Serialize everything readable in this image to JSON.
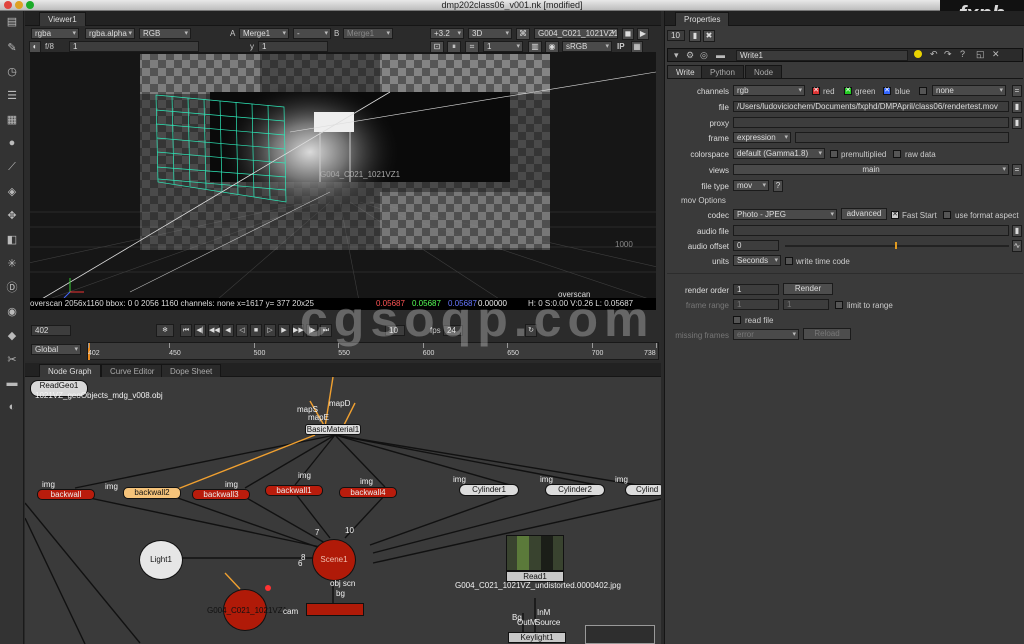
{
  "window": {
    "title": "dmp202class06_v001.nk [modified]",
    "logo": "fxph"
  },
  "viewer": {
    "tab": "Viewer1",
    "channels": "rgba",
    "alpha": "rgba.alpha",
    "display": "RGB",
    "a_label": "A",
    "a_input": "Merge1",
    "op": "-",
    "b_label": "B",
    "b_input": "Merge1",
    "gain": "+3.2",
    "mode3d": "3D",
    "camera": "G004_C021_1021VZ1",
    "fstop": "f/8",
    "exposure": "1",
    "y_label": "y",
    "gamma": "1",
    "proxy": "1",
    "lut": "sRGB",
    "ip": "IP",
    "info": "overscan 2056x1160 bbox: 0 0 2056 1160 channels: none   x=1617 y= 377   20x25",
    "pix_r": "0.05687",
    "pix_g": "0.05687",
    "pix_b": "0.05687",
    "pix_a": "0.00000",
    "pix_hsv": "H:  0 S:0.00 V:0.26  L: 0.05687",
    "overscan_label": "overscan",
    "scene_label": "G004_C021_1021VZ1",
    "grid_value": "1000",
    "frame": "402",
    "fps_label": "fps",
    "fps": "24",
    "step": "10",
    "global": "Global",
    "timeline_ticks": [
      "402",
      "450",
      "500",
      "550",
      "600",
      "650",
      "700",
      "738"
    ]
  },
  "nodegraph": {
    "tabs": [
      "Node Graph",
      "Curve Editor",
      "Dope Sheet"
    ],
    "nodes": {
      "readgeo": "ReadGeo1",
      "readgeo_sub": "1021VZ_geoObjects_mdg_v008.obj",
      "basic_material": "BasicMaterial1",
      "maps": "mapS",
      "mapd": "mapD",
      "mape": "mapE",
      "backwall_a": "backwall",
      "backwall2": "backwall2",
      "backwall3": "backwall3",
      "backwall1": "backwall1",
      "backwall4": "backwall4",
      "cylinder1": "Cylinder1",
      "cylinder2": "Cylinder2",
      "cylinder3": "Cylind",
      "light": "Light1",
      "scene": "Scene1",
      "camera": "G004_C021_1021VZ1",
      "cam_label": "cam",
      "obj_scn": "obj scn",
      "bg": "bg",
      "read": "Read1",
      "read_sub": "G004_C021_1021VZ_undistorted.0000402.jpg",
      "keylight": "Keylight1",
      "bg_in": "Bg",
      "inm": "InM",
      "outm": "OutM",
      "source": "Source",
      "img": "img",
      "num7": "7",
      "num10": "10",
      "num8": "8",
      "num6": "6"
    }
  },
  "properties": {
    "tab": "Properties",
    "max_panels": "10",
    "node_name": "Write1",
    "tabs": [
      "Write",
      "Python",
      "Node"
    ],
    "channels_label": "channels",
    "channels": "rgb",
    "red": "red",
    "green": "green",
    "blue": "blue",
    "alpha_sel": "none",
    "file_label": "file",
    "file": "/Users/ludoviciochem/Documents/fxphd/DMPApril/class06/rendertest.mov",
    "proxy_label": "proxy",
    "frame_label": "frame",
    "frame": "expression",
    "colorspace_label": "colorspace",
    "colorspace": "default (Gamma1.8)",
    "premult": "premultiplied",
    "raw": "raw data",
    "views_label": "views",
    "views": "main",
    "filetype_label": "file type",
    "filetype": "mov",
    "help": "?",
    "mov_options": "mov Options",
    "codec_label": "codec",
    "codec": "Photo - JPEG",
    "advanced": "advanced",
    "faststart": "Fast Start",
    "useformat": "use format aspect",
    "audio_label": "audio file",
    "audio_offset_label": "audio offset",
    "audio_offset": "0",
    "units_label": "units",
    "units": "Seconds",
    "write_tc": "write time code",
    "render_order_label": "render order",
    "render_order": "1",
    "render": "Render",
    "frame_range_label": "frame range",
    "fr_start": "1",
    "fr_end": "1",
    "limit": "limit to range",
    "read_file": "read file",
    "missing_label": "missing frames",
    "missing": "error",
    "reload": "Reload"
  },
  "watermark": "cgsoqp.com"
}
